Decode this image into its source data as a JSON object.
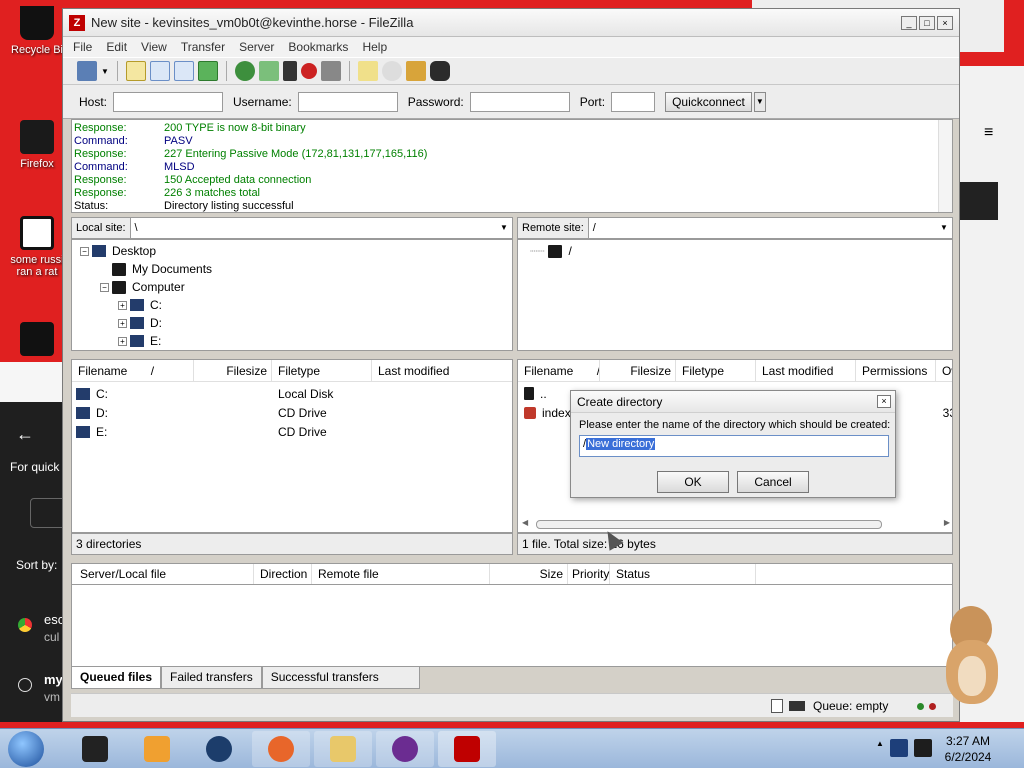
{
  "desktop": {
    "recycle_bin_label": "Recycle Bi",
    "firefox_label": "Firefox",
    "file_label_line1": "some russi",
    "file_label_line2": "ran a rat",
    "side_texts": [
      "For quick",
      "Sort by:",
      "esc",
      "cul",
      "my",
      "vm"
    ]
  },
  "window": {
    "title": "New site - kevinsites_vm0b0t@kevinthe.horse - FileZilla",
    "logo_letter": "Z"
  },
  "menu": [
    "File",
    "Edit",
    "View",
    "Transfer",
    "Server",
    "Bookmarks",
    "Help"
  ],
  "quickconnect": {
    "host_label": "Host:",
    "username_label": "Username:",
    "password_label": "Password:",
    "port_label": "Port:",
    "button_label": "Quickconnect",
    "host_value": "",
    "username_value": "",
    "password_value": "",
    "port_value": ""
  },
  "log": [
    {
      "type": "Response:",
      "text": "200 TYPE is now 8-bit binary",
      "color": "#008000"
    },
    {
      "type": "Command:",
      "text": "PASV",
      "color": "#000080"
    },
    {
      "type": "Response:",
      "text": "227 Entering Passive Mode (172,81,131,177,165,116)",
      "color": "#008000"
    },
    {
      "type": "Command:",
      "text": "MLSD",
      "color": "#000080"
    },
    {
      "type": "Response:",
      "text": "150 Accepted data connection",
      "color": "#008000"
    },
    {
      "type": "Response:",
      "text": "226 3 matches total",
      "color": "#008000"
    },
    {
      "type": "Status:",
      "text": "Directory listing successful",
      "color": "#000000"
    }
  ],
  "local": {
    "site_label": "Local site:",
    "path": "\\",
    "tree": [
      {
        "label": "Desktop",
        "expander": "−"
      },
      {
        "label": "My Documents",
        "expander": ""
      },
      {
        "label": "Computer",
        "expander": "−"
      },
      {
        "label": "C:",
        "expander": "+"
      },
      {
        "label": "D:",
        "expander": "+"
      },
      {
        "label": "E:",
        "expander": "+"
      }
    ],
    "columns": [
      "Filename",
      "/",
      "Filesize",
      "Filetype",
      "Last modified"
    ],
    "files": [
      {
        "name": "C:",
        "type": "Local Disk"
      },
      {
        "name": "D:",
        "type": "CD Drive"
      },
      {
        "name": "E:",
        "type": "CD Drive"
      }
    ],
    "status": "3 directories"
  },
  "remote": {
    "site_label": "Remote site:",
    "path": "/",
    "tree": [
      {
        "label": "/"
      }
    ],
    "columns": [
      "Filename",
      "/",
      "Filesize",
      "Filetype",
      "Last modified",
      "Permissions",
      "Ow"
    ],
    "files": [
      {
        "name": "..",
        "extra": ""
      },
      {
        "name": "index.",
        "extra": "33"
      }
    ],
    "status": "1 file. Total size: 16 bytes"
  },
  "queue": {
    "columns": [
      "Server/Local file",
      "Direction",
      "Remote file",
      "Size",
      "Priority",
      "Status"
    ],
    "tabs": [
      "Queued files",
      "Failed transfers",
      "Successful transfers"
    ],
    "status": "Queue: empty"
  },
  "dialog": {
    "title": "Create directory",
    "message": "Please enter the name of the directory which should be created:",
    "value_prefix": "/",
    "value_selected": "New directory",
    "ok_label": "OK",
    "cancel_label": "Cancel"
  },
  "taskbar": {
    "time": "3:27 AM",
    "date": "6/2/2024"
  },
  "colors": {
    "desktop_red": "#e02020",
    "filezilla_red": "#bf0000",
    "selection_blue": "#3a6fd8"
  }
}
